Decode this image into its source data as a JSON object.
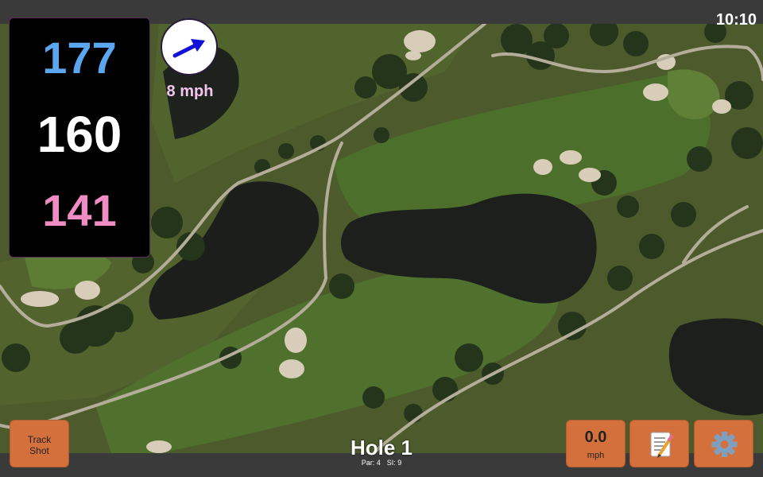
{
  "status_bar": {
    "time": "10:10"
  },
  "distances": {
    "back": {
      "value": "177",
      "color": "#5aa7f0"
    },
    "middle": {
      "value": "160",
      "color": "#ffffff"
    },
    "front": {
      "value": "141",
      "color": "#f08cc4"
    }
  },
  "wind": {
    "speed_label": "8 mph",
    "label_color": "#f3c4ee",
    "arrow_color": "#1212d8",
    "arrow_icon": "arrow-up-right-icon"
  },
  "track_shot": {
    "line1": "Track",
    "line2": "Shot"
  },
  "speed": {
    "value": "0.0",
    "unit": "mph"
  },
  "notes": {
    "icon": "memo-icon"
  },
  "settings": {
    "icon": "gear-icon"
  },
  "hole": {
    "title": "Hole 1",
    "par": "Par: 4",
    "si": "SI: 9"
  },
  "colors": {
    "button": "#d4703c",
    "fairway": "#4f6e2e",
    "rough": "#4e5a2e",
    "water": "#1c1f1c",
    "sand": "#d8cdb8",
    "cart_path": "#b4ad9a"
  }
}
